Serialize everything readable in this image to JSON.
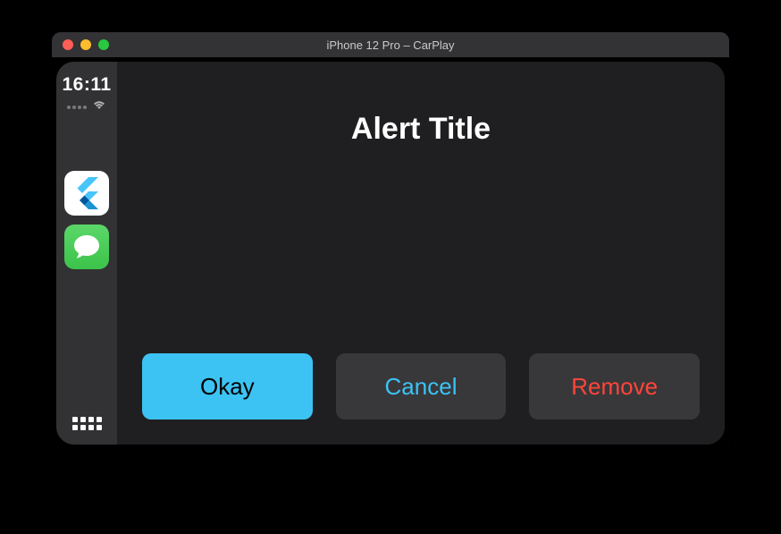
{
  "window": {
    "title": "iPhone 12 Pro – CarPlay"
  },
  "sidebar": {
    "clock": "16:11",
    "apps": [
      {
        "name": "flutter"
      },
      {
        "name": "messages"
      }
    ]
  },
  "alert": {
    "title": "Alert Title",
    "buttons": {
      "okay": "Okay",
      "cancel": "Cancel",
      "remove": "Remove"
    }
  },
  "colors": {
    "accent_blue": "#3cc3f4",
    "destructive_red": "#ff453a",
    "button_bg": "#38383a"
  }
}
